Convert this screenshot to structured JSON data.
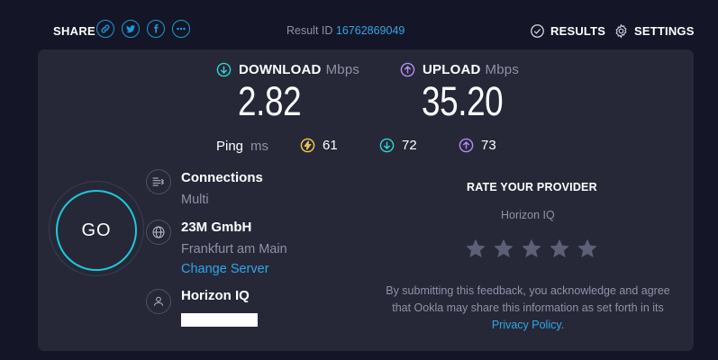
{
  "header": {
    "share_label": "SHARE",
    "share_icons": [
      "link-icon",
      "twitter-icon",
      "facebook-icon",
      "more-icon"
    ],
    "result_id_label": "Result ID",
    "result_id_value": "16762869049",
    "results_label": "RESULTS",
    "settings_label": "SETTINGS"
  },
  "speeds": {
    "download": {
      "label": "DOWNLOAD",
      "unit": "Mbps",
      "value": "2.82",
      "icon": "download-arrow-icon",
      "color": "#2fd3d0"
    },
    "upload": {
      "label": "UPLOAD",
      "unit": "Mbps",
      "value": "35.20",
      "icon": "upload-arrow-icon",
      "color": "#b58cf5"
    }
  },
  "ping": {
    "label": "Ping",
    "unit": "ms",
    "idle": {
      "value": "61",
      "icon": "ping-bolt-icon",
      "color": "#f1cd4b"
    },
    "download": {
      "value": "72",
      "icon": "download-arrow-icon",
      "color": "#2fd3d0"
    },
    "upload": {
      "value": "73",
      "icon": "upload-arrow-icon",
      "color": "#b58cf5"
    }
  },
  "go_button_label": "GO",
  "connections": {
    "title": "Connections",
    "value": "Multi",
    "icon": "connections-icon"
  },
  "server": {
    "title": "23M GmbH",
    "location": "Frankfurt am Main",
    "change_label": "Change Server",
    "icon": "globe-icon"
  },
  "provider": {
    "title": "Horizon IQ",
    "icon": "user-icon"
  },
  "rating": {
    "title": "RATE YOUR PROVIDER",
    "provider_name": "Horizon IQ",
    "stars": 5,
    "disclaimer_text": "By submitting this feedback, you acknowledge and agree that Ookla may share this information as set forth in its",
    "privacy_link": "Privacy Policy",
    "disclaimer_end": "."
  },
  "colors": {
    "background": "#141526",
    "card": "#262838",
    "accent": "#2fa7e8",
    "go_ring": "#1fc8d8",
    "muted": "#8f91a6"
  }
}
